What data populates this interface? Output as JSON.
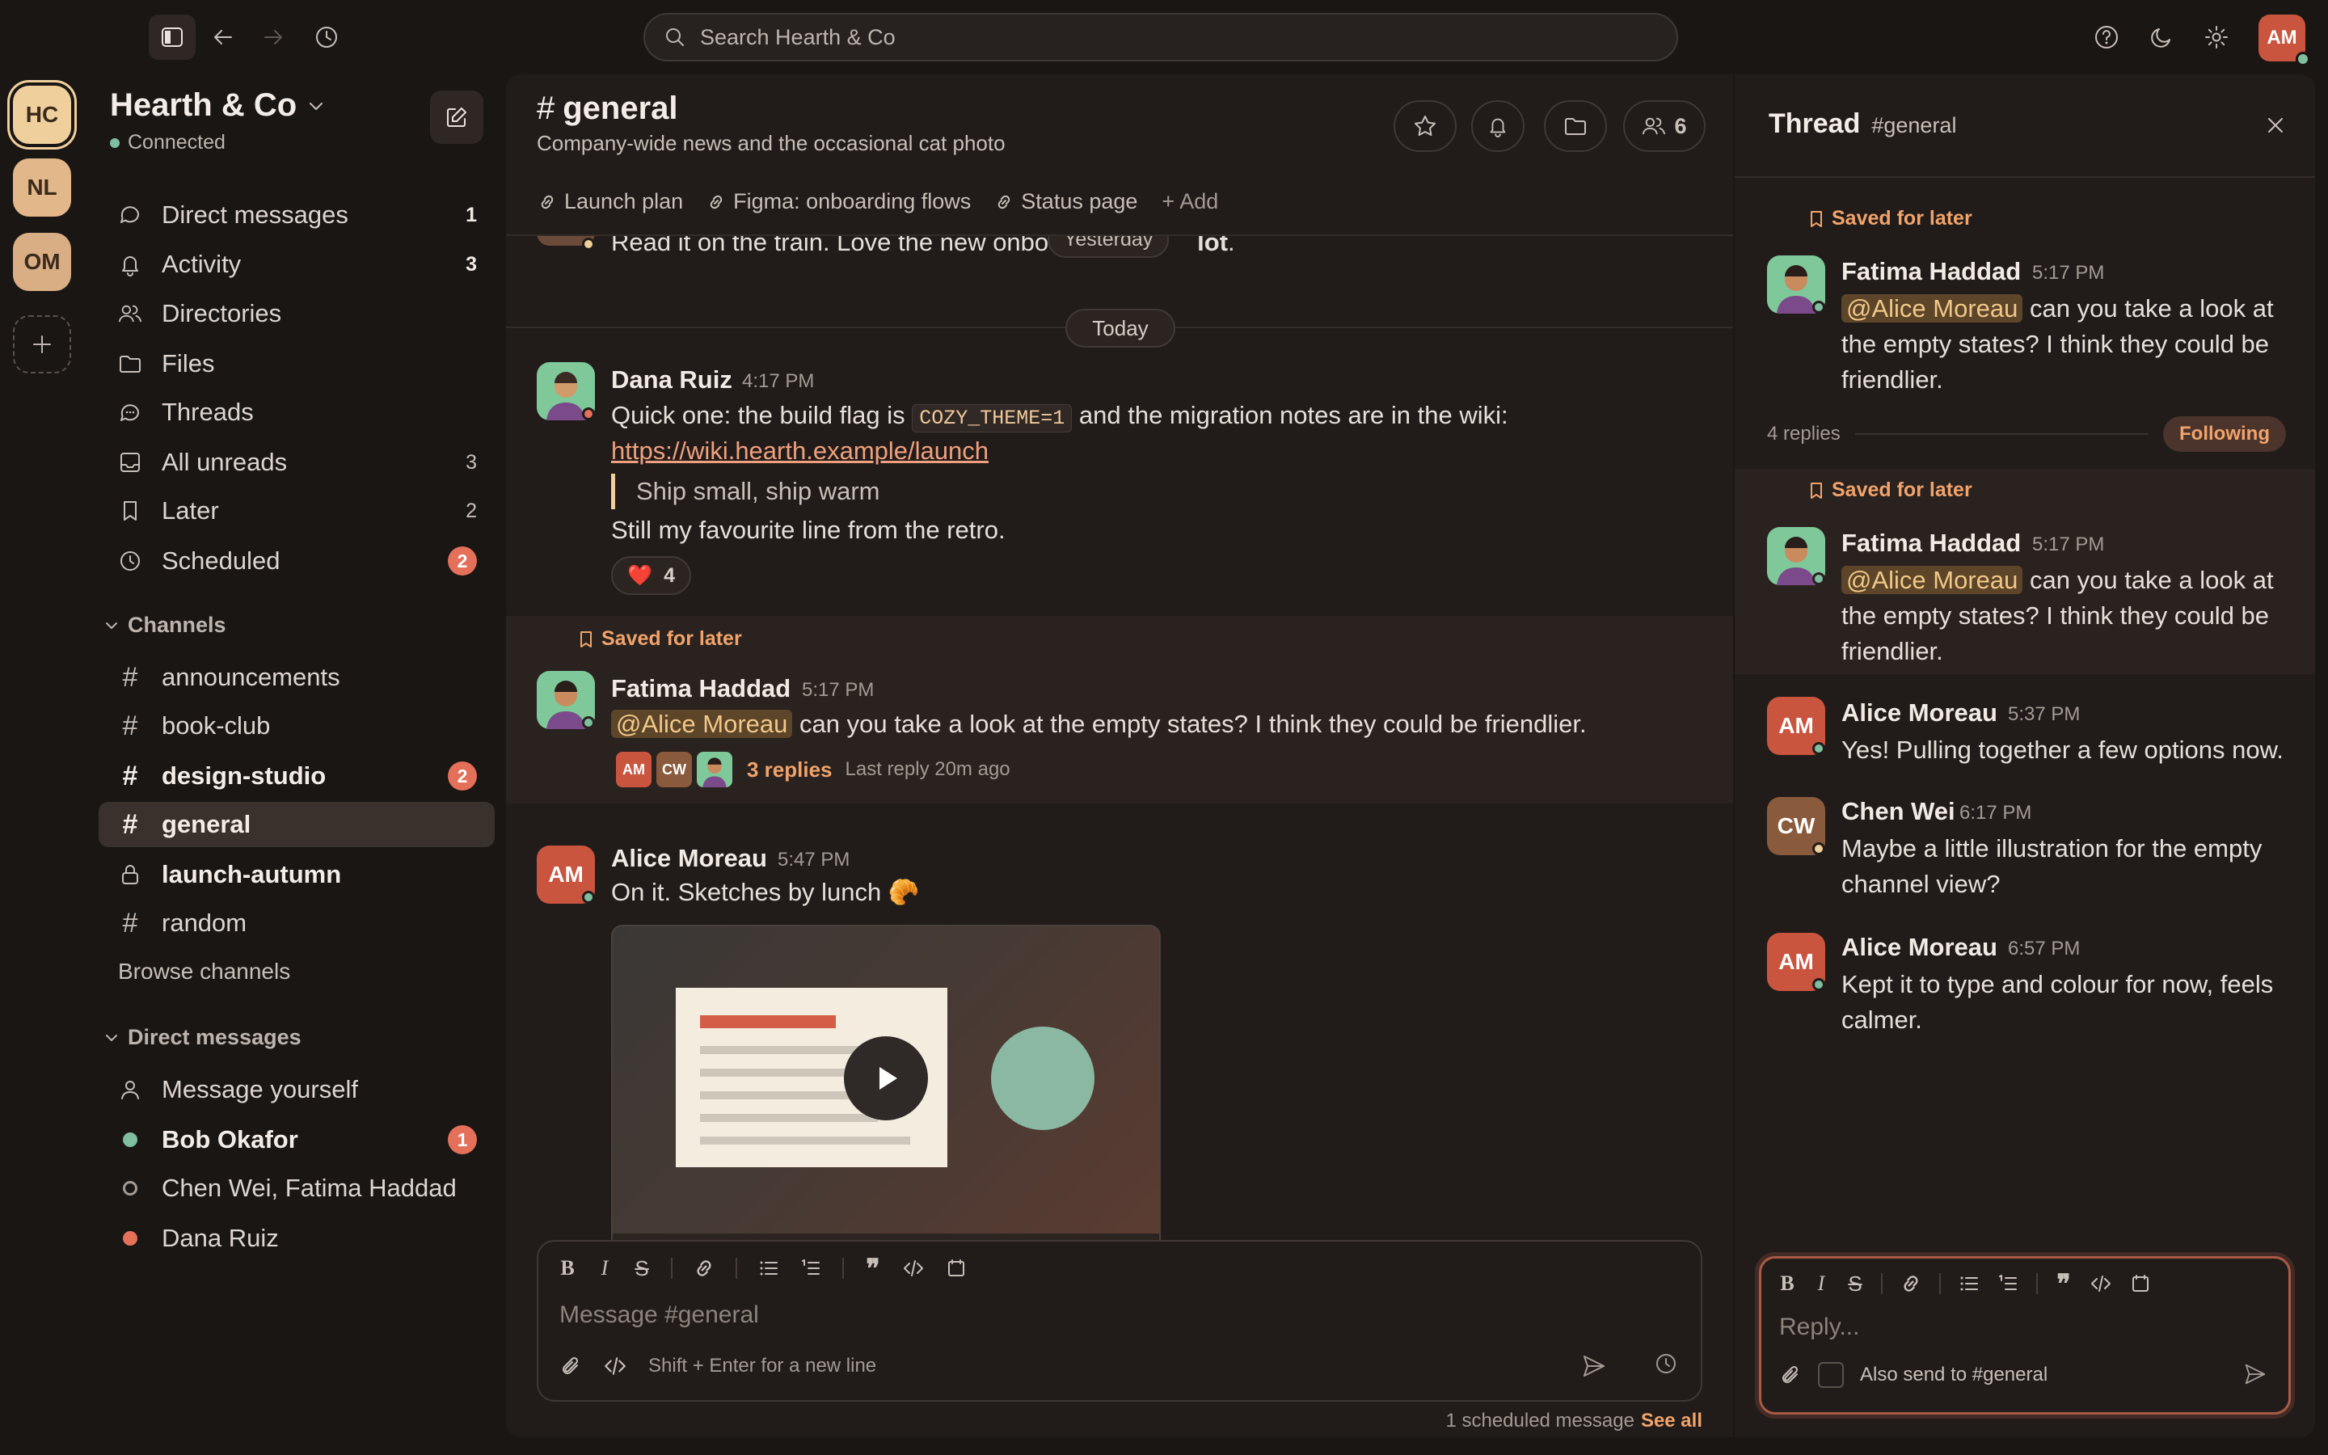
{
  "topbar": {
    "search_placeholder": "Search Hearth & Co",
    "avatar": "AM"
  },
  "workspaces": [
    "HC",
    "NL",
    "OM"
  ],
  "sidebar": {
    "workspace_name": "Hearth & Co",
    "status": "Connected",
    "nav": [
      {
        "label": "Direct messages",
        "count": "1",
        "icon": "chat-icon"
      },
      {
        "label": "Activity",
        "count": "3",
        "icon": "bell-icon"
      },
      {
        "label": "Directories",
        "count": "",
        "icon": "people-icon"
      },
      {
        "label": "Files",
        "count": "",
        "icon": "folder-icon"
      },
      {
        "label": "Threads",
        "count": "",
        "icon": "threads-icon"
      },
      {
        "label": "All unreads",
        "count": "3",
        "icon": "inbox-icon"
      },
      {
        "label": "Later",
        "count": "2",
        "icon": "bookmark-icon"
      },
      {
        "label": "Scheduled",
        "count": "2",
        "icon": "clock-icon"
      }
    ],
    "channels_heading": "Channels",
    "channels": [
      {
        "name": "announcements",
        "badge": ""
      },
      {
        "name": "book-club",
        "badge": ""
      },
      {
        "name": "design-studio",
        "badge": "2"
      },
      {
        "name": "general",
        "badge": ""
      },
      {
        "name": "launch-autumn",
        "badge": ""
      },
      {
        "name": "random",
        "badge": ""
      }
    ],
    "browse_channels": "Browse channels",
    "dm_heading": "Direct messages",
    "dms": [
      {
        "name": "Message yourself",
        "badge": ""
      },
      {
        "name": "Bob Okafor",
        "badge": "1"
      },
      {
        "name": "Chen Wei, Fatima Haddad",
        "badge": ""
      },
      {
        "name": "Dana Ruiz",
        "badge": ""
      }
    ]
  },
  "channel": {
    "name": "general",
    "description": "Company-wide news and the occasional cat photo",
    "member_count": "6",
    "bookmarks": [
      "Launch plan",
      "Figma: onboarding flows",
      "Status page"
    ],
    "add_bookmark": "+ Add",
    "prev_text": "Read it on the train. Love the new onbo",
    "prev_bold": "lot",
    "yesterday": "Yesterday",
    "today": "Today"
  },
  "messages": {
    "m1": {
      "author": "Dana Ruiz",
      "time": "4:17 PM",
      "text1": "Quick one: the build flag is",
      "code": "COZY_THEME=1",
      "text2": "and the migration notes are in the wiki:",
      "link": "https://wiki.hearth.example/launch",
      "quote": "Ship small, ship warm",
      "text3": "Still my favourite line from the retro.",
      "reaction": "❤️",
      "reaction_count": "4"
    },
    "m2": {
      "saved": "Saved for later",
      "author": "Fatima Haddad",
      "time": "5:17 PM",
      "mention": "@Alice Moreau",
      "text": "can you take a look at the empty states? I think they could be friendlier.",
      "avatars": [
        "AM",
        "CW"
      ],
      "replies": "3 replies",
      "last_reply": "Last reply 20m ago"
    },
    "m3": {
      "author": "Alice Moreau",
      "initials": "AM",
      "time": "5:47 PM",
      "text": "On it. Sketches by lunch 🥐"
    }
  },
  "composer": {
    "placeholder": "Message #general",
    "hint": "Shift + Enter for a new line",
    "scheduled": "1 scheduled message",
    "see_all": "See all"
  },
  "thread": {
    "title": "Thread",
    "channel": "#general",
    "saved": "Saved for later",
    "root": {
      "author": "Fatima Haddad",
      "time": "5:17 PM",
      "mention": "@Alice Moreau",
      "text": "can you take a look at the empty states? I think they could be friendlier."
    },
    "reply_count": "4 replies",
    "following": "Following",
    "replies": [
      {
        "author": "Alice Moreau",
        "initials": "AM",
        "time": "5:37 PM",
        "text": "Yes! Pulling together a few options now."
      },
      {
        "author": "Chen Wei",
        "initials": "CW",
        "time": "6:17 PM",
        "text": "Maybe a little illustration for the empty channel view?"
      },
      {
        "author": "Alice Moreau",
        "initials": "AM",
        "time": "6:57 PM",
        "text": "Kept it to type and colour for now, feels calmer."
      }
    ],
    "reply_placeholder": "Reply...",
    "also_send": "Also send to #general"
  },
  "colors": {
    "accent": "#e4705a",
    "saved": "#f1a36b",
    "online": "#7fbfa0",
    "link": "#f0a07e"
  }
}
